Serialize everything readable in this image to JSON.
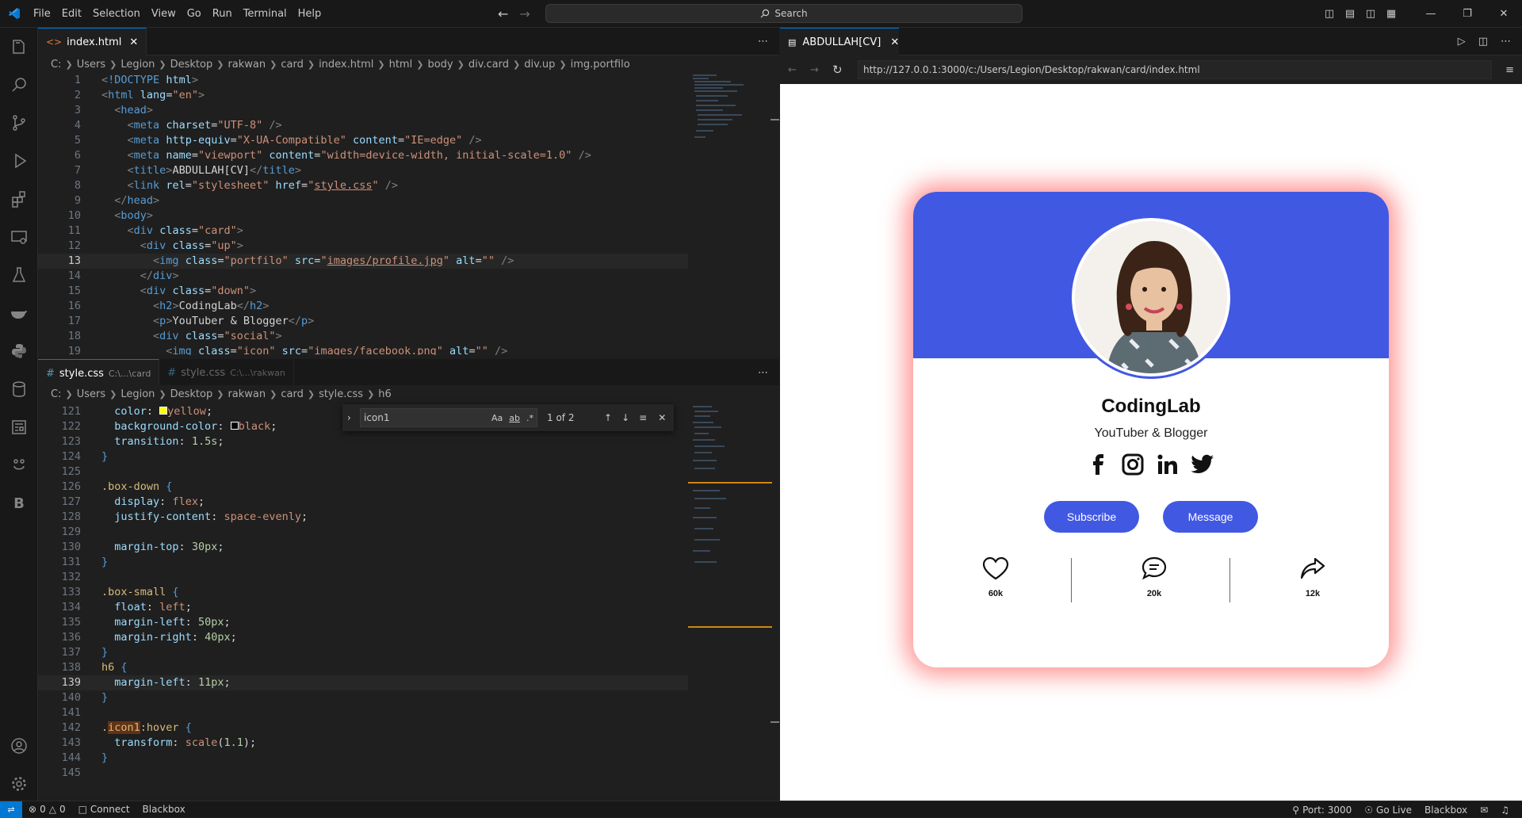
{
  "menu": [
    "File",
    "Edit",
    "Selection",
    "View",
    "Go",
    "Run",
    "Terminal",
    "Help"
  ],
  "search": {
    "label": "Search"
  },
  "editor_top": {
    "tab_label": "index.html",
    "breadcrumbs": [
      "C:",
      "Users",
      "Legion",
      "Desktop",
      "rakwan",
      "card",
      "index.html",
      "html",
      "body",
      "div.card",
      "div.up",
      "img.portfilo"
    ],
    "lines": [
      {
        "n": "1",
        "html": "<span class='pu'>&lt;</span><span class='tg'>!DOCTYPE</span> <span class='at'>html</span><span class='pu'>&gt;</span>"
      },
      {
        "n": "2",
        "html": "<span class='pu'>&lt;</span><span class='tg'>html</span> <span class='at'>lang</span>=<span class='st'>\"en\"</span><span class='pu'>&gt;</span>"
      },
      {
        "n": "3",
        "html": "  <span class='pu'>&lt;</span><span class='tg'>head</span><span class='pu'>&gt;</span>"
      },
      {
        "n": "4",
        "html": "    <span class='pu'>&lt;</span><span class='tg'>meta</span> <span class='at'>charset</span>=<span class='st'>\"UTF-8\"</span> <span class='pu'>/&gt;</span>"
      },
      {
        "n": "5",
        "html": "    <span class='pu'>&lt;</span><span class='tg'>meta</span> <span class='at'>http-equiv</span>=<span class='st'>\"X-UA-Compatible\"</span> <span class='at'>content</span>=<span class='st'>\"IE=edge\"</span> <span class='pu'>/&gt;</span>"
      },
      {
        "n": "6",
        "html": "    <span class='pu'>&lt;</span><span class='tg'>meta</span> <span class='at'>name</span>=<span class='st'>\"viewport\"</span> <span class='at'>content</span>=<span class='st'>\"width=device-width, initial-scale=1.0\"</span> <span class='pu'>/&gt;</span>"
      },
      {
        "n": "7",
        "html": "    <span class='pu'>&lt;</span><span class='tg'>title</span><span class='pu'>&gt;</span>ABDULLAH[CV]<span class='pu'>&lt;/</span><span class='tg'>title</span><span class='pu'>&gt;</span>"
      },
      {
        "n": "8",
        "html": "    <span class='pu'>&lt;</span><span class='tg'>link</span> <span class='at'>rel</span>=<span class='st'>\"stylesheet\"</span> <span class='at'>href</span>=<span class='st'>\"<u>style.css</u>\"</span> <span class='pu'>/&gt;</span>"
      },
      {
        "n": "9",
        "html": "  <span class='pu'>&lt;/</span><span class='tg'>head</span><span class='pu'>&gt;</span>"
      },
      {
        "n": "10",
        "html": "  <span class='pu'>&lt;</span><span class='tg'>body</span><span class='pu'>&gt;</span>"
      },
      {
        "n": "11",
        "html": "    <span class='pu'>&lt;</span><span class='tg'>div</span> <span class='at'>class</span>=<span class='st'>\"card\"</span><span class='pu'>&gt;</span>"
      },
      {
        "n": "12",
        "html": "      <span class='pu'>&lt;</span><span class='tg'>div</span> <span class='at'>class</span>=<span class='st'>\"up\"</span><span class='pu'>&gt;</span>"
      },
      {
        "n": "13",
        "html": "        <span class='pu'>&lt;</span><span class='tg'>img</span> <span class='at'>class</span>=<span class='st'>\"portfilo\"</span> <span class='at'>src</span>=<span class='st'>\"<u>images/profile.jpg</u>\"</span> <span class='at'>alt</span>=<span class='st'>\"\"</span> <span class='pu'>/&gt;</span>",
        "current": true
      },
      {
        "n": "14",
        "html": "      <span class='pu'>&lt;/</span><span class='tg'>div</span><span class='pu'>&gt;</span>"
      },
      {
        "n": "15",
        "html": "      <span class='pu'>&lt;</span><span class='tg'>div</span> <span class='at'>class</span>=<span class='st'>\"down\"</span><span class='pu'>&gt;</span>"
      },
      {
        "n": "16",
        "html": "        <span class='pu'>&lt;</span><span class='tg'>h2</span><span class='pu'>&gt;</span>CodingLab<span class='pu'>&lt;/</span><span class='tg'>h2</span><span class='pu'>&gt;</span>"
      },
      {
        "n": "17",
        "html": "        <span class='pu'>&lt;</span><span class='tg'>p</span><span class='pu'>&gt;</span>YouTuber &amp; Blogger<span class='pu'>&lt;/</span><span class='tg'>p</span><span class='pu'>&gt;</span>"
      },
      {
        "n": "18",
        "html": "        <span class='pu'>&lt;</span><span class='tg'>div</span> <span class='at'>class</span>=<span class='st'>\"social\"</span><span class='pu'>&gt;</span>"
      },
      {
        "n": "19",
        "html": "          <span class='pu'>&lt;</span><span class='tg'>img</span> <span class='at'>class</span>=<span class='st'>\"icon\"</span> <span class='at'>src</span>=<span class='st'>\"<u>images/facebook.png</u>\"</span> <span class='at'>alt</span>=<span class='st'>\"\"</span> <span class='pu'>/&gt;</span>"
      }
    ]
  },
  "editor_bottom": {
    "tabs": [
      {
        "label": "style.css",
        "sub": "C:\\...\\card"
      },
      {
        "label": "style.css",
        "sub": "C:\\...\\rakwan"
      }
    ],
    "breadcrumbs": [
      "C:",
      "Users",
      "Legion",
      "Desktop",
      "rakwan",
      "card",
      "style.css",
      "h6"
    ],
    "find": {
      "value": "icon1",
      "count": "1 of 2",
      "opt_case": "Aa",
      "opt_word": "ab",
      "opt_regex": ".*"
    },
    "lines": [
      {
        "n": "121",
        "html": "  <span class='pr'>color</span>: <span style='display:inline-block;width:10px;height:10px;background:#ffff00;border:1px solid #fff;'></span><span class='vl'>yellow</span>;"
      },
      {
        "n": "122",
        "html": "  <span class='pr'>background-color</span>: <span style='display:inline-block;width:10px;height:10px;background:#000;border:1px solid #fff;'></span><span class='vl'>black</span>;"
      },
      {
        "n": "123",
        "html": "  <span class='pr'>transition</span>: <span class='nm'>1.5s</span>;"
      },
      {
        "n": "124",
        "html": "<span class='tg'>}</span>"
      },
      {
        "n": "125",
        "html": ""
      },
      {
        "n": "126",
        "html": "<span class='sel'>.box-down</span> <span class='tg'>{</span>"
      },
      {
        "n": "127",
        "html": "  <span class='pr'>display</span>: <span class='vl'>flex</span>;"
      },
      {
        "n": "128",
        "html": "  <span class='pr'>justify-content</span>: <span class='vl'>space-evenly</span>;"
      },
      {
        "n": "129",
        "html": ""
      },
      {
        "n": "130",
        "html": "  <span class='pr'>margin-top</span>: <span class='nm'>30px</span>;"
      },
      {
        "n": "131",
        "html": "<span class='tg'>}</span>"
      },
      {
        "n": "132",
        "html": ""
      },
      {
        "n": "133",
        "html": "<span class='sel'>.box-small</span> <span class='tg'>{</span>"
      },
      {
        "n": "134",
        "html": "  <span class='pr'>float</span>: <span class='vl'>left</span>;"
      },
      {
        "n": "135",
        "html": "  <span class='pr'>margin-left</span>: <span class='nm'>50px</span>;"
      },
      {
        "n": "136",
        "html": "  <span class='pr'>margin-right</span>: <span class='nm'>40px</span>;"
      },
      {
        "n": "137",
        "html": "<span class='tg'>}</span>"
      },
      {
        "n": "138",
        "html": "<span class='sel'>h6</span> <span class='tg'>{</span>"
      },
      {
        "n": "139",
        "html": "  <span class='pr'>margin-left</span>: <span class='nm'>11px</span>;",
        "current": true
      },
      {
        "n": "140",
        "html": "<span class='tg'>}</span>"
      },
      {
        "n": "141",
        "html": ""
      },
      {
        "n": "142",
        "html": "<span class='sel'>.<span class='hl'>icon1</span>:hover</span> <span class='tg'>{</span>"
      },
      {
        "n": "143",
        "html": "  <span class='pr'>transform</span>: <span class='vl'>scale</span>(<span class='nm'>1.1</span>);"
      },
      {
        "n": "144",
        "html": "<span class='tg'>}</span>"
      },
      {
        "n": "145",
        "html": ""
      }
    ]
  },
  "browser": {
    "tab_label": "ABDULLAH[CV]",
    "url": "http://127.0.0.1:3000/c:/Users/Legion/Desktop/rakwan/card/index.html",
    "card": {
      "name": "CodingLab",
      "role": "YouTuber & Blogger",
      "subscribe": "Subscribe",
      "message": "Message",
      "stats": [
        {
          "icon": "heart-icon",
          "value": "60k"
        },
        {
          "icon": "comment-icon",
          "value": "20k"
        },
        {
          "icon": "share-icon",
          "value": "12k"
        }
      ],
      "accent": "#4158e3",
      "glow": "#ff3c3c"
    }
  },
  "statusbar": {
    "errors": "0",
    "warnings": "0",
    "connect": "Connect",
    "blackbox": "Blackbox",
    "port": "Port: 3000",
    "golive": "Go Live",
    "blackbox_right": "Blackbox"
  }
}
